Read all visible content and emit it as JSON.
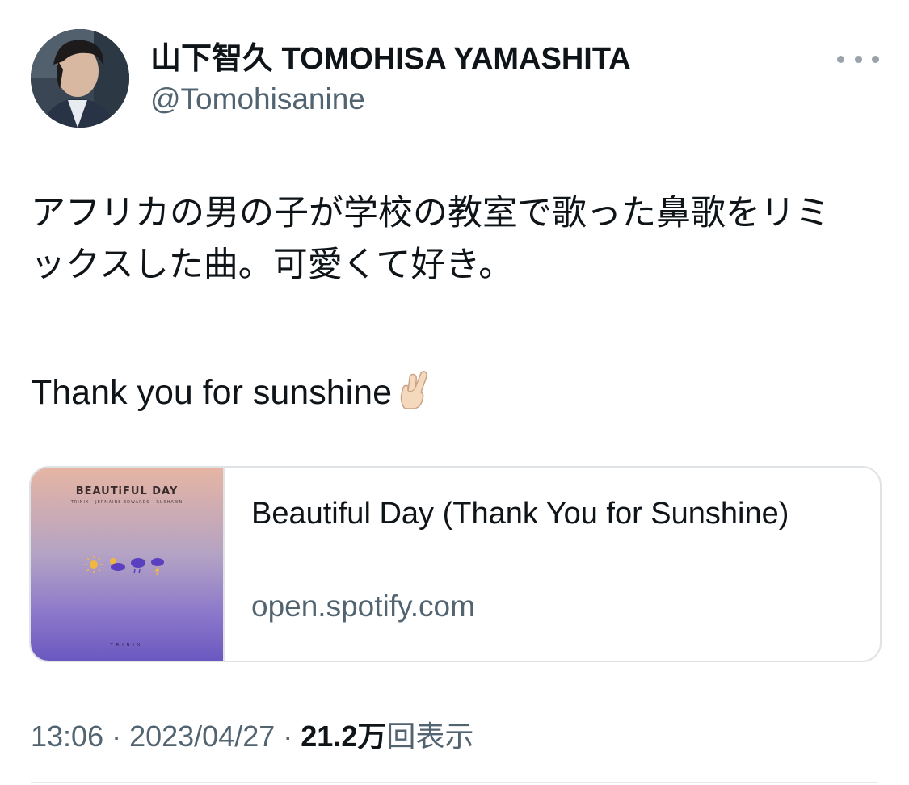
{
  "user": {
    "display_name": "山下智久 TOMOHISA YAMASHITA",
    "handle": "@Tomohisanine"
  },
  "tweet": {
    "line1": "アフリカの男の子が学校の教室で歌った鼻歌をリミ",
    "line2": "ックスした曲。可愛くて好き。",
    "line3": "Thank you for sunshine",
    "emoji": "crossed-fingers-emoji"
  },
  "card": {
    "thumbnail_title": "BEAUTiFUL DAY",
    "thumbnail_credits": "TRINIX · JERMAINE EDWARDS · RUSHAWN",
    "thumbnail_label": "TRINIX",
    "title": "Beautiful Day (Thank You for Sunshine)",
    "domain": "open.spotify.com"
  },
  "meta": {
    "time": "13:06",
    "sep1": " · ",
    "date": "2023/04/27",
    "sep2": " · ",
    "views": "21.2万",
    "views_label": "回表示"
  },
  "colors": {
    "text": "#0f1419",
    "secondary": "#536471",
    "border": "#dfe3e6"
  }
}
